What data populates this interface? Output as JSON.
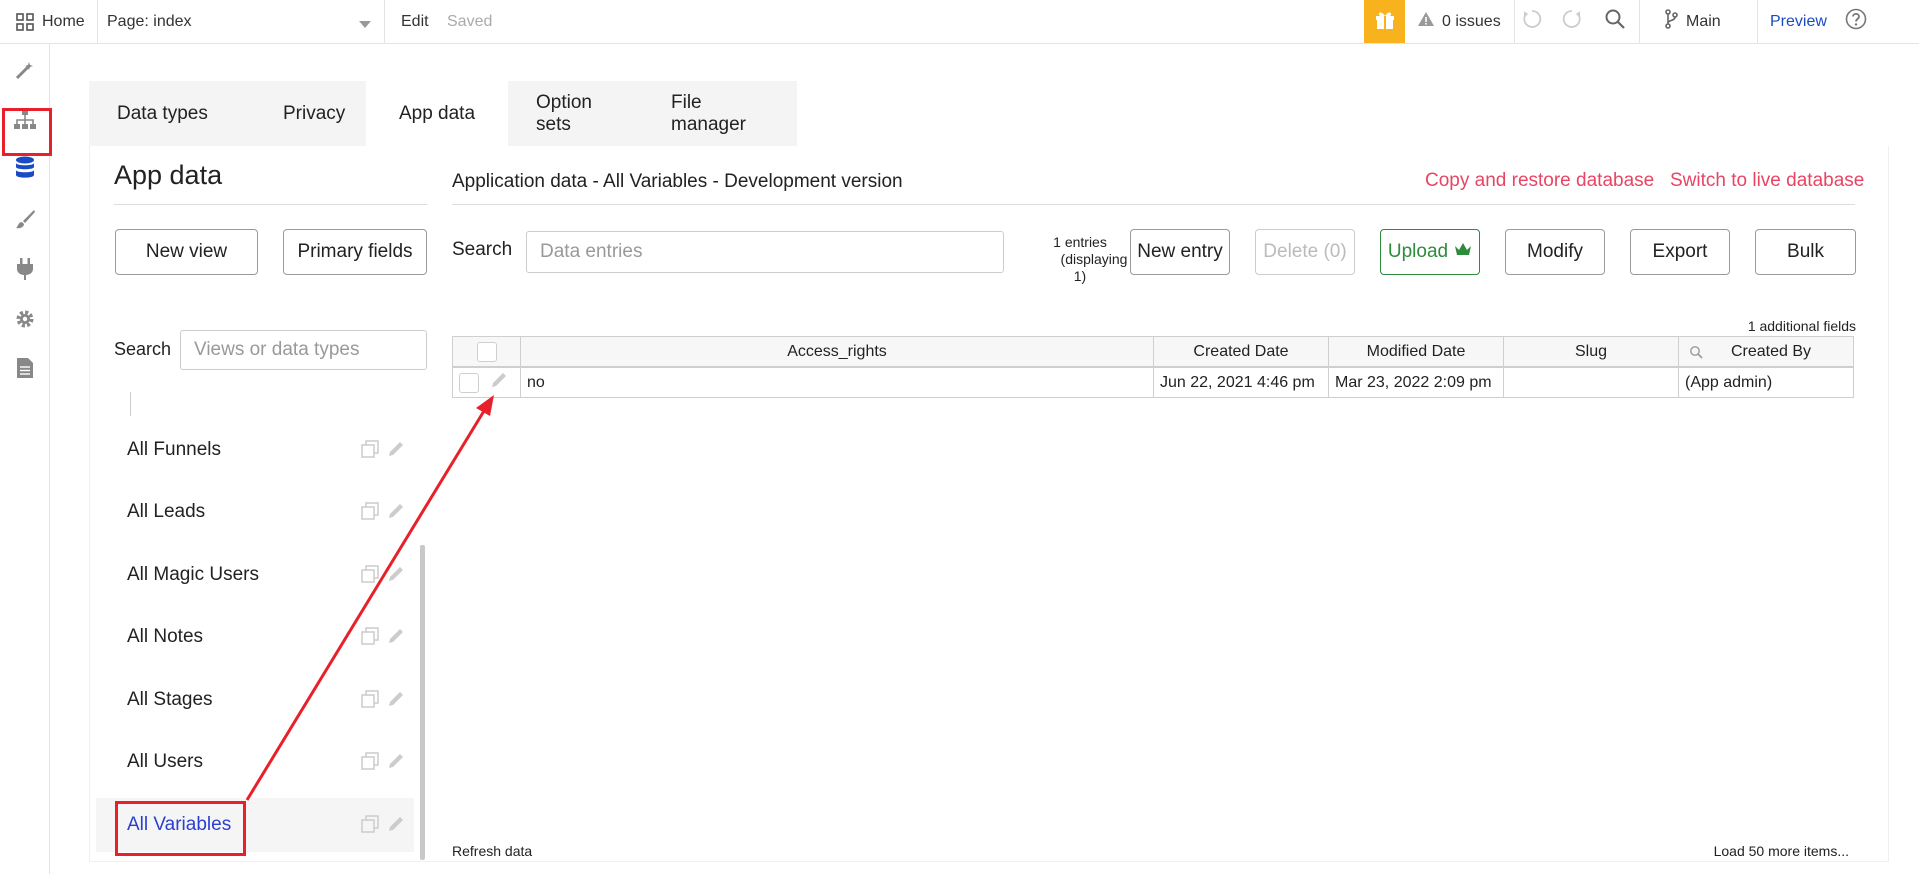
{
  "topbar": {
    "home_label": "Home",
    "page_label": "Page: index",
    "edit_label": "Edit",
    "saved_label": "Saved",
    "issues_label": "0 issues",
    "branch_label": "Main",
    "preview_label": "Preview"
  },
  "tabs": [
    {
      "label": "Data types"
    },
    {
      "label": "Privacy"
    },
    {
      "label": "App data"
    },
    {
      "label": "Option sets"
    },
    {
      "label": "File manager"
    }
  ],
  "sidebar": {
    "title": "App data",
    "new_view_label": "New view",
    "primary_fields_label": "Primary fields",
    "search_label": "Search",
    "search_placeholder": "Views or data types",
    "items": [
      {
        "label": "All Funnels"
      },
      {
        "label": "All Leads"
      },
      {
        "label": "All Magic Users"
      },
      {
        "label": "All Notes"
      },
      {
        "label": "All Stages"
      },
      {
        "label": "All Users"
      },
      {
        "label": "All Variables"
      }
    ]
  },
  "main": {
    "heading": "Application data - All Variables - Development version",
    "copy_restore_label": "Copy and restore database",
    "switch_live_label": "Switch to live database",
    "search_label": "Search",
    "search_placeholder": "Data entries",
    "entries_line1": "1 entries",
    "entries_line2": "(displaying",
    "entries_line3": "1)",
    "new_entry_label": "New entry",
    "delete_label": "Delete (0)",
    "upload_label": "Upload",
    "modify_label": "Modify",
    "export_label": "Export",
    "bulk_label": "Bulk",
    "additional_fields": "1 additional fields",
    "refresh_label": "Refresh data",
    "load_more_label": "Load 50 more items..."
  },
  "table": {
    "columns": [
      "Access_rights",
      "Created Date",
      "Modified Date",
      "Slug",
      "Created By"
    ],
    "rows": [
      [
        "no",
        "Jun 22, 2021 4:46 pm",
        "Mar 23, 2022 2:09 pm",
        "",
        "(App admin)"
      ]
    ]
  },
  "colors": {
    "accent_red": "#e84565",
    "highlight_red": "#e8202a",
    "gift_yellow": "#f7b21e",
    "link_blue": "#1a4bc4",
    "upload_green": "#2e8b3c"
  }
}
